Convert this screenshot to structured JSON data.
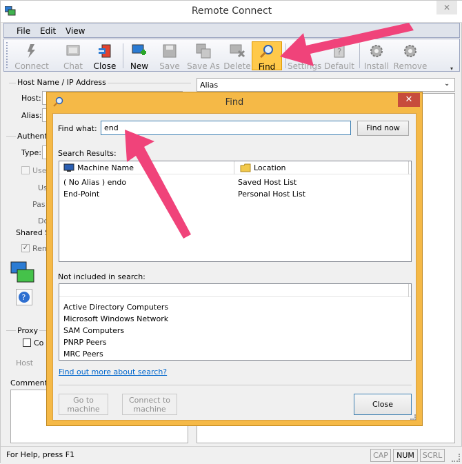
{
  "window": {
    "title": "Remote Connect",
    "close_glyph": "✕"
  },
  "menu": [
    "File",
    "Edit",
    "View"
  ],
  "toolbar": {
    "connect": "Connect",
    "chat": "Chat",
    "close": "Close",
    "new": "New",
    "save": "Save",
    "save_as": "Save As",
    "delete": "Delete",
    "find": "Find",
    "settings": "Settings",
    "default": "Default",
    "install": "Install",
    "remove": "Remove"
  },
  "left": {
    "host_group": "Host Name / IP Address",
    "host_label": "Host:",
    "alias_label": "Alias:",
    "auth_group": "Authentic",
    "type_label": "Type:",
    "use_label": "Use",
    "user_label": "Us",
    "pass_label": "Pas",
    "domain_label": "Do",
    "shared_label": "Shared S",
    "rem_label": "Rem",
    "proxy_group": "Proxy",
    "proxy_check": "Co",
    "host2_label": "Host",
    "comments_label": "Comments:"
  },
  "right": {
    "alias_dropdown": "Alias"
  },
  "status": {
    "help": "For Help, press F1",
    "cap": "CAP",
    "num": "NUM",
    "scrl": "SCRL"
  },
  "dialog": {
    "title": "Find",
    "close_glyph": "✕",
    "find_what_label": "Find what:",
    "find_value": "end",
    "find_now": "Find now",
    "results_label": "Search Results:",
    "col_machine": "Machine Name",
    "col_location": "Location",
    "results": [
      {
        "machine": "( No Alias ) endo",
        "location": "Saved Host List"
      },
      {
        "machine": "End-Point",
        "location": "Personal Host List"
      }
    ],
    "not_included_label": "Not included in search:",
    "excluded": [
      "Active Directory Computers",
      "Microsoft Windows Network",
      "SAM Computers",
      "PNRP Peers",
      "MRC Peers"
    ],
    "find_more_link": "Find out more about search?",
    "go_to_machine": [
      "Go to",
      "machine"
    ],
    "connect_to_machine": [
      "Connect to",
      "machine"
    ],
    "close": "Close"
  },
  "colors": {
    "annotation_arrow": "#f0437a",
    "active_button": "#ffc94a",
    "dialog_frame": "#f5b947",
    "dialog_close": "#c74c3c"
  }
}
